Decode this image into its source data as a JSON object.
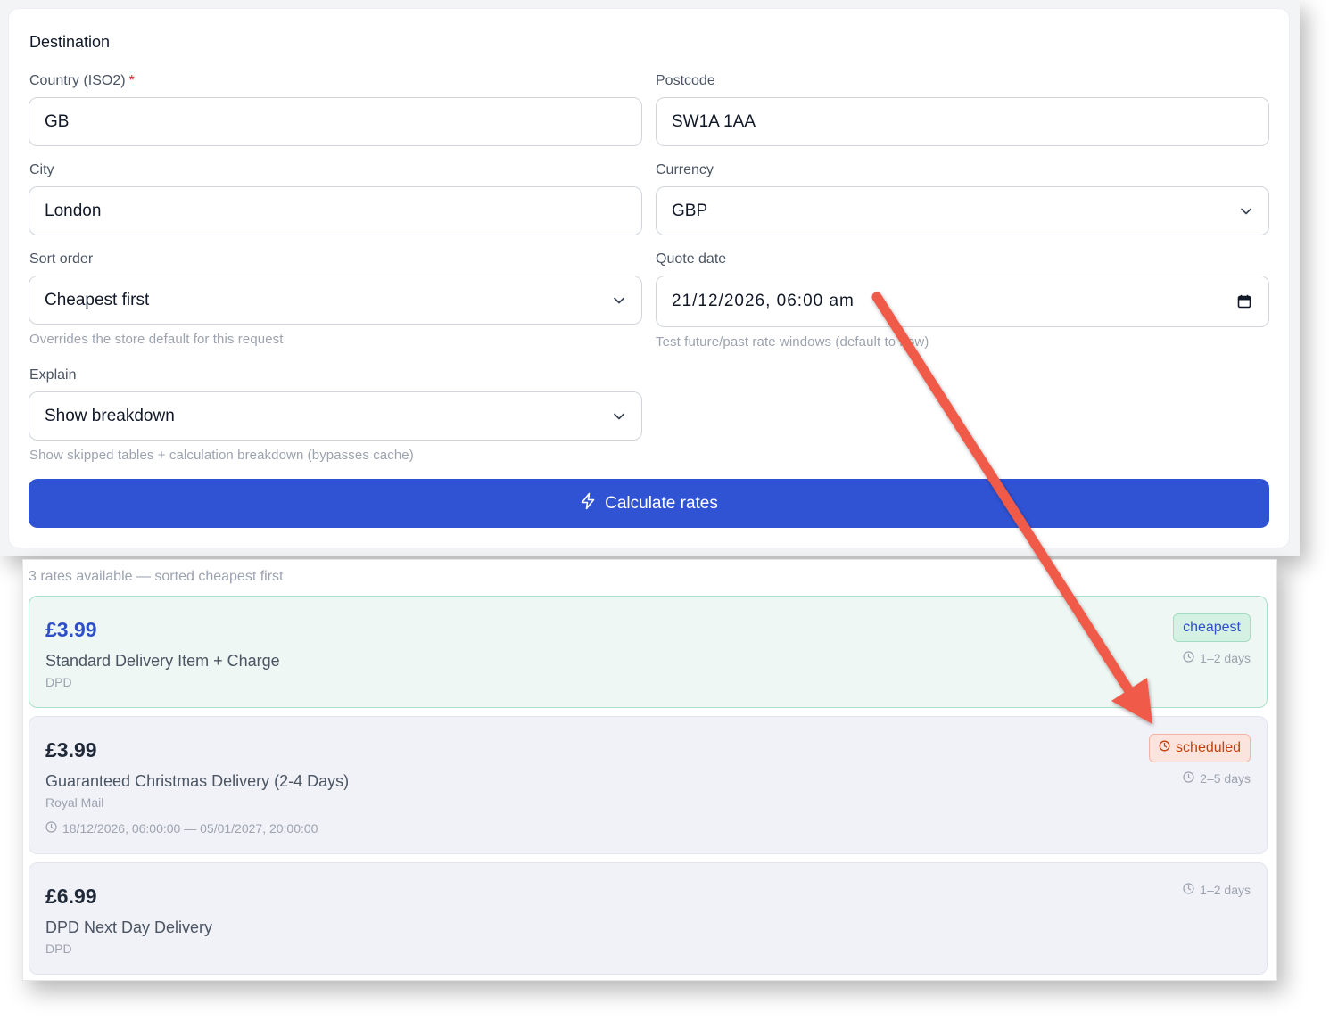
{
  "form": {
    "section_title": "Destination",
    "country": {
      "label": "Country (ISO2)",
      "required_mark": "*",
      "value": "GB"
    },
    "postcode": {
      "label": "Postcode",
      "value": "SW1A 1AA"
    },
    "city": {
      "label": "City",
      "value": "London"
    },
    "currency": {
      "label": "Currency",
      "value": "GBP"
    },
    "sort_order": {
      "label": "Sort order",
      "value": "Cheapest first",
      "hint": "Overrides the store default for this request"
    },
    "quote_date": {
      "label": "Quote date",
      "value": "21/12/2026, 06:00 am",
      "hint": "Test future/past rate windows (default to now)"
    },
    "explain": {
      "label": "Explain",
      "value": "Show breakdown",
      "hint": "Show skipped tables + calculation breakdown (bypasses cache)"
    },
    "calculate_label": "Calculate rates"
  },
  "results": {
    "summary": "3 rates available — sorted cheapest first",
    "rates": [
      {
        "price": "£3.99",
        "name": "Standard Delivery Item + Charge",
        "carrier": "DPD",
        "badge": "cheapest",
        "days": "1–2 days"
      },
      {
        "price": "£3.99",
        "name": "Guaranteed Christmas Delivery (2-4 Days)",
        "carrier": "Royal Mail",
        "badge": "scheduled",
        "days": "2–5 days",
        "window": "18/12/2026, 06:00:00 — 05/01/2027, 20:00:00"
      },
      {
        "price": "£6.99",
        "name": "DPD Next Day Delivery",
        "carrier": "DPD",
        "days": "1–2 days"
      }
    ]
  },
  "colors": {
    "accent": "#3053d4",
    "annotation_arrow": "#ef5a4a",
    "cheapest_bg": "#eef7f3",
    "scheduled_badge": "#c2410c"
  }
}
